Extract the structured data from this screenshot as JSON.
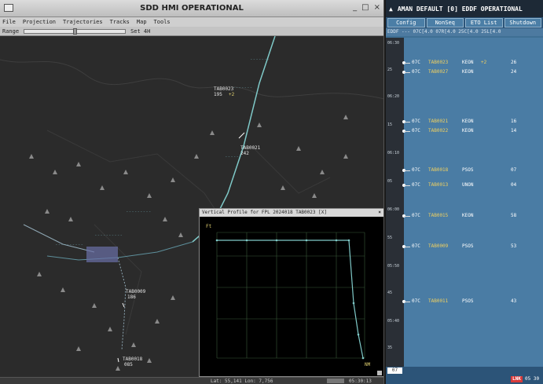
{
  "hmi": {
    "title": "SDD HMI OPERATIONAL",
    "window_buttons": [
      "_",
      "□",
      "×"
    ],
    "menu": [
      "File",
      "Projection",
      "Trajectories",
      "Tracks",
      "Map",
      "Tools"
    ],
    "range_label": "Range",
    "set_label": "Set 4H",
    "map_labels": [
      {
        "text": "TAB0023",
        "cls": "w"
      },
      {
        "text": "195",
        "cls": "w"
      },
      {
        "text": "+2",
        "cls": "y"
      },
      {
        "text": "TAB0021",
        "cls": "w"
      },
      {
        "text": "242",
        "cls": "w"
      },
      {
        "text": "TAB0009",
        "cls": "w"
      },
      {
        "text": "186",
        "cls": "w"
      },
      {
        "text": "TAB0018",
        "cls": "w"
      },
      {
        "text": "085",
        "cls": "w"
      }
    ],
    "status_coords": "Lat: 55,141  Lon: 7,756",
    "status_clock": "05:30:13"
  },
  "vertical_profile": {
    "title": "Vertical Profile for FPL 2024018 TAB0023 [X]",
    "close": "×",
    "y_unit": "Ft",
    "x_unit": "NM"
  },
  "aman": {
    "title": "AMAN DEFAULT [0] EDDF OPERATIONAL",
    "tabs": [
      "Config",
      "NonSeq",
      "ETO List",
      "Shutdown"
    ],
    "header": "EDDF ---  07C[4.0  07R[4.0  25C[4.0  25L[4.0",
    "time_labels": [
      "06:30",
      "25",
      "06:20",
      "15",
      "06:10",
      "05",
      "06:00",
      "55",
      "05:50",
      "45",
      "05:40",
      "35"
    ],
    "rows": [
      {
        "rw": "07C",
        "cs": "TAB0023",
        "fix": "KEON",
        "plus": "+2",
        "eta": "26"
      },
      {
        "rw": "07C",
        "cs": "TAB0027",
        "fix": "KEON",
        "plus": "",
        "eta": "24"
      },
      {
        "rw": "07C",
        "cs": "TAB0021",
        "fix": "KEON",
        "plus": "",
        "eta": "16"
      },
      {
        "rw": "07C",
        "cs": "TAB0022",
        "fix": "KEON",
        "plus": "",
        "eta": "14"
      },
      {
        "rw": "07C",
        "cs": "TAB0018",
        "fix": "PSOS",
        "plus": "",
        "eta": "07"
      },
      {
        "rw": "07C",
        "cs": "TAB0013",
        "fix": "UNON",
        "plus": "",
        "eta": "04"
      },
      {
        "rw": "07C",
        "cs": "TAB0015",
        "fix": "KEON",
        "plus": "",
        "eta": "58"
      },
      {
        "rw": "07C",
        "cs": "TAB0009",
        "fix": "PSOS",
        "plus": "",
        "eta": "53"
      },
      {
        "rw": "07C",
        "cs": "TAB0011",
        "fix": "PSOS",
        "plus": "",
        "eta": "43"
      }
    ],
    "bottom_box": "07",
    "link": "LNK",
    "time": "05 30"
  }
}
